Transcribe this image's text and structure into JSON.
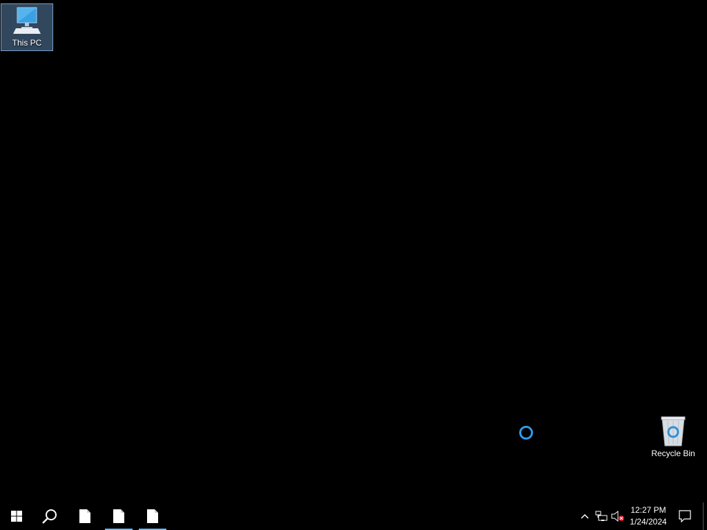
{
  "desktop": {
    "icons": [
      {
        "label": "This PC",
        "icon": "this-pc-icon",
        "selected": true
      },
      {
        "label": "Recycle Bin",
        "icon": "recycle-bin-icon",
        "selected": false
      }
    ],
    "background_color": "#000000"
  },
  "taskbar": {
    "start_icon": "windows-logo-icon",
    "search_icon": "search-icon",
    "apps": [
      {
        "icon": "document-icon",
        "active": false
      },
      {
        "icon": "document-icon",
        "active": true
      },
      {
        "icon": "document-icon",
        "active": true
      }
    ],
    "accent_color": "#76b9ed",
    "tray": {
      "chevron_icon": "chevron-up-icon",
      "network_icon": "network-icon",
      "volume_icon": "volume-muted-icon"
    },
    "clock": {
      "time": "12:27 PM",
      "date": "1/24/2024"
    },
    "action_center_icon": "notification-icon"
  },
  "cursor": {
    "type": "busy",
    "color": "#2e9be8"
  }
}
